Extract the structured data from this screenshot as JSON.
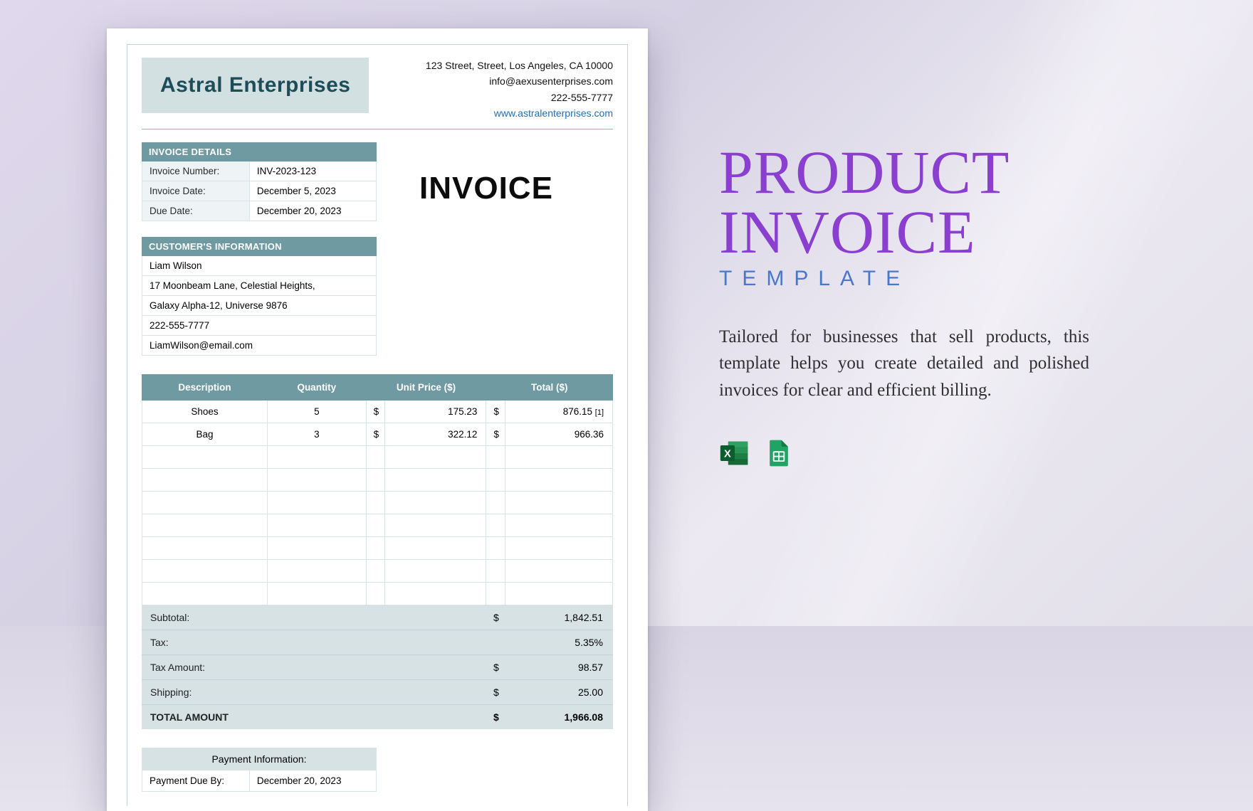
{
  "company": {
    "name": "Astral Enterprises",
    "address": "123 Street, Street, Los Angeles, CA 10000",
    "email": "info@aexusenterprises.com",
    "phone": "222-555-7777",
    "website": "www.astralenterprises.com"
  },
  "invoice_word": "INVOICE",
  "invoice_details": {
    "heading": "INVOICE DETAILS",
    "rows": [
      {
        "k": "Invoice Number:",
        "v": "INV-2023-123"
      },
      {
        "k": "Invoice Date:",
        "v": "December 5, 2023"
      },
      {
        "k": "Due Date:",
        "v": "December 20, 2023"
      }
    ]
  },
  "customer": {
    "heading": "CUSTOMER'S INFORMATION",
    "lines": [
      "Liam Wilson",
      "17 Moonbeam Lane, Celestial Heights,",
      "Galaxy Alpha-12, Universe 9876",
      "222-555-7777",
      "LiamWilson@email.com"
    ]
  },
  "items": {
    "headers": [
      "Description",
      "Quantity",
      "Unit Price ($)",
      "Total ($)"
    ],
    "rows": [
      {
        "desc": "Shoes",
        "qty": "5",
        "unit": "175.23",
        "total": "876.15",
        "note": "[1]"
      },
      {
        "desc": "Bag",
        "qty": "3",
        "unit": "322.12",
        "total": "966.36",
        "note": ""
      }
    ],
    "blank_rows": 7,
    "currency": "$"
  },
  "totals": [
    {
      "label": "Subtotal:",
      "cur": "$",
      "val": "1,842.51",
      "bold": false
    },
    {
      "label": "Tax:",
      "cur": "",
      "val": "5.35%",
      "bold": false
    },
    {
      "label": "Tax Amount:",
      "cur": "$",
      "val": "98.57",
      "bold": false
    },
    {
      "label": "Shipping:",
      "cur": "$",
      "val": "25.00",
      "bold": false
    },
    {
      "label": "TOTAL AMOUNT",
      "cur": "$",
      "val": "1,966.08",
      "bold": true
    }
  ],
  "payment": {
    "heading": "Payment Information:",
    "rows": [
      {
        "k": "Payment Due By:",
        "v": "December 20, 2023"
      }
    ]
  },
  "promo": {
    "title_line1": "PRODUCT",
    "title_line2": "INVOICE",
    "subtitle": "TEMPLATE",
    "desc": "Tailored for businesses that sell products, this template helps you create detailed and polished invoices for clear and efficient billing."
  },
  "icons": {
    "excel": "excel-icon",
    "sheets": "google-sheets-icon"
  }
}
